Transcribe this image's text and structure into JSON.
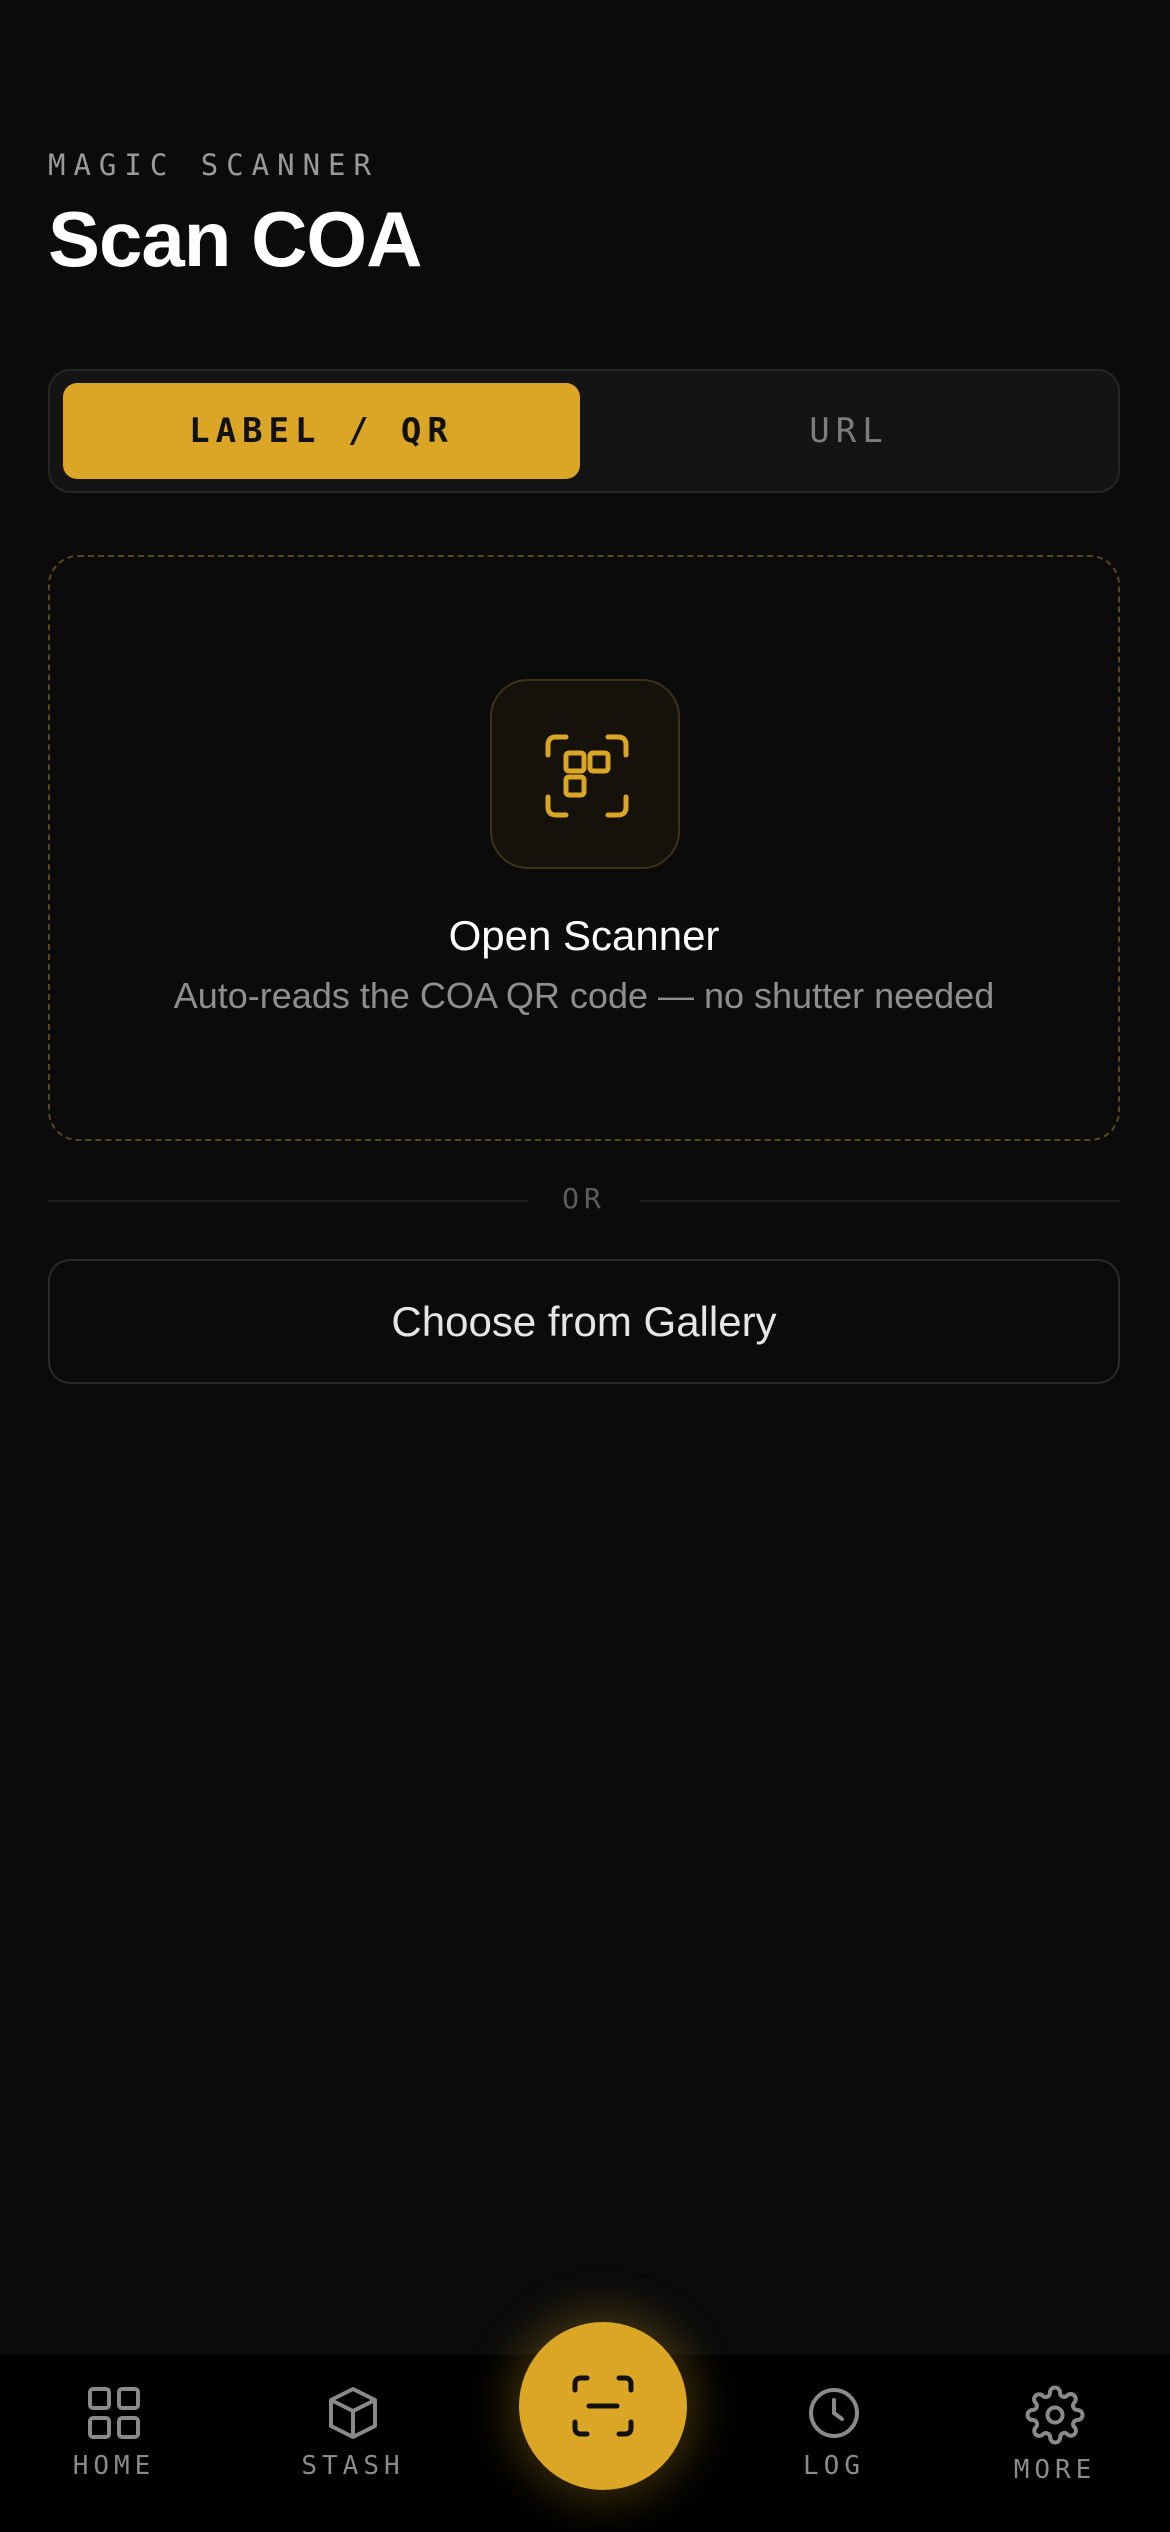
{
  "header": {
    "eyebrow": "MAGIC SCANNER",
    "title": "Scan COA"
  },
  "mode_toggle": {
    "options": [
      {
        "label": "LABEL / QR",
        "selected": true
      },
      {
        "label": "URL",
        "selected": false
      }
    ]
  },
  "scanner_card": {
    "title": "Open Scanner",
    "subtitle": "Auto-reads the COA QR code — no shutter needed",
    "icon": "qr-scan-icon"
  },
  "divider": {
    "label": "OR"
  },
  "gallery_button": {
    "label": "Choose from Gallery"
  },
  "bottom_nav": {
    "items": [
      {
        "label": "HOME",
        "icon": "grid-icon"
      },
      {
        "label": "STASH",
        "icon": "box-icon"
      },
      {
        "label": "LOG",
        "icon": "clock-icon"
      },
      {
        "label": "MORE",
        "icon": "gear-icon"
      }
    ],
    "fab_icon": "scan-icon"
  },
  "colors": {
    "accent": "#dba625",
    "background": "#0b0b0b",
    "nav_background": "#000000"
  }
}
